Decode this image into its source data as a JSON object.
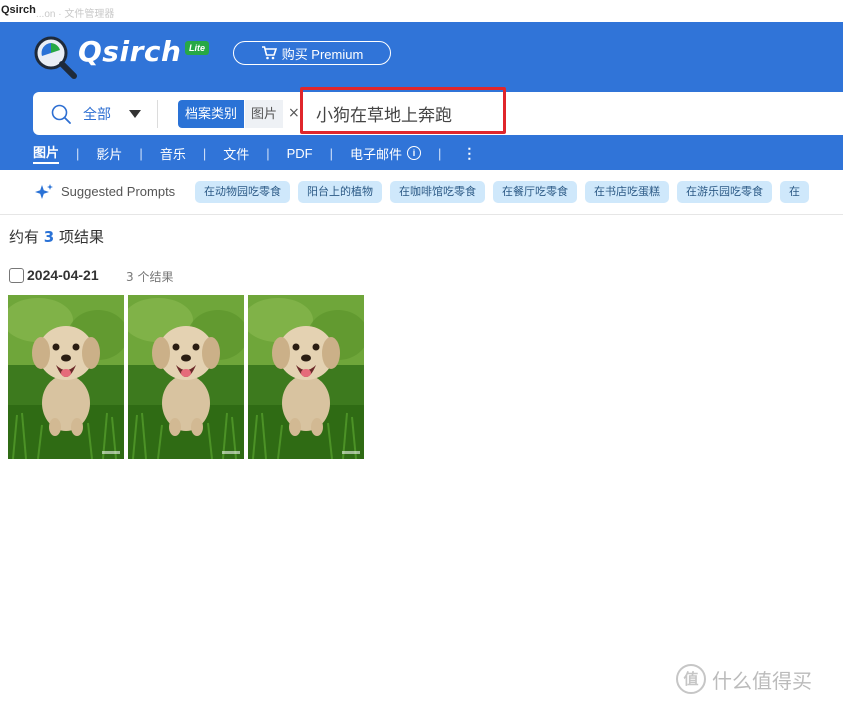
{
  "window": {
    "app_name": "Qsirch",
    "subtitle": "...on · 文件管理器"
  },
  "header": {
    "brand": "Qsirch",
    "edition_badge": "Lite",
    "premium_button": "购买 Premium",
    "colors": {
      "header_bg": "#3074d8",
      "accent": "#2a72d6",
      "badge_green": "#27a845",
      "highlight_red": "#e0262b"
    }
  },
  "search": {
    "scope_label": "全部",
    "filter_category": "档案类别",
    "filter_value": "图片",
    "query": "小狗在草地上奔跑"
  },
  "tabs": [
    {
      "label": "图片",
      "active": true
    },
    {
      "label": "影片"
    },
    {
      "label": "音乐"
    },
    {
      "label": "文件"
    },
    {
      "label": "PDF"
    },
    {
      "label": "电子邮件"
    }
  ],
  "tab_separator": "|",
  "prompts": {
    "label": "Suggested Prompts",
    "items": [
      "在动物园吃零食",
      "阳台上的植物",
      "在咖啡馆吃零食",
      "在餐厅吃零食",
      "在书店吃蛋糕",
      "在游乐园吃零食",
      "在"
    ]
  },
  "results": {
    "prefix": "约有",
    "count": "3",
    "suffix": "项结果",
    "group": {
      "date": "2024-04-21",
      "count_label": "3 个结果",
      "thumbnails": [
        "dog-photo-1",
        "dog-photo-2",
        "dog-photo-3"
      ]
    }
  },
  "watermark": {
    "icon": "值",
    "text": "什么值得买"
  }
}
